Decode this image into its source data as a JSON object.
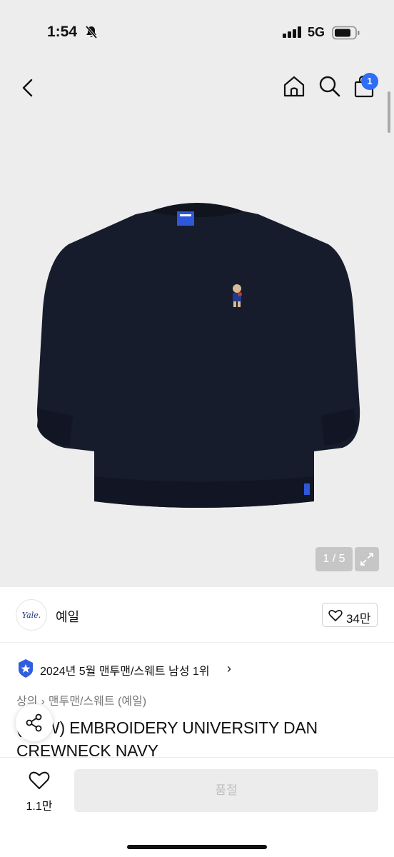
{
  "status_bar": {
    "time": "1:54",
    "network": "5G",
    "bell_icon": "bell-slash-icon",
    "signal_icon": "signal-icon",
    "battery_icon": "battery-icon"
  },
  "nav": {
    "back_icon": "chevron-left-icon",
    "home_icon": "home-icon",
    "search_icon": "search-icon",
    "cart_icon": "shopping-bag-icon",
    "cart_badge": "1"
  },
  "gallery": {
    "counter": "1 / 5",
    "expand_icon": "expand-icon",
    "image_subject": "navy crewneck sweatshirt"
  },
  "brand": {
    "logo_text": "Yale.",
    "name": "예일",
    "like_count": "34만",
    "like_icon": "heart-outline-icon"
  },
  "ranking": {
    "text": "2024년 5월 맨투맨/스웨트 남성 1위",
    "chevron": "›",
    "medal_icon": "star-medal-icon"
  },
  "breadcrumb": {
    "items": [
      "상의",
      "맨투맨/스웨트 (예일)"
    ],
    "separator": "›"
  },
  "product": {
    "title": "(NEW) EMBROIDERY UNIVERSITY DAN CREWNECK NAVY"
  },
  "share": {
    "icon": "share-icon"
  },
  "bottom_bar": {
    "wish_count": "1.1만",
    "wish_icon": "heart-outline-icon",
    "soldout_label": "품절"
  },
  "colors": {
    "accent": "#2f6df6",
    "sweatshirt": "#171c2c",
    "hero_bg": "#ededed",
    "disabled_button": "#ececec"
  }
}
